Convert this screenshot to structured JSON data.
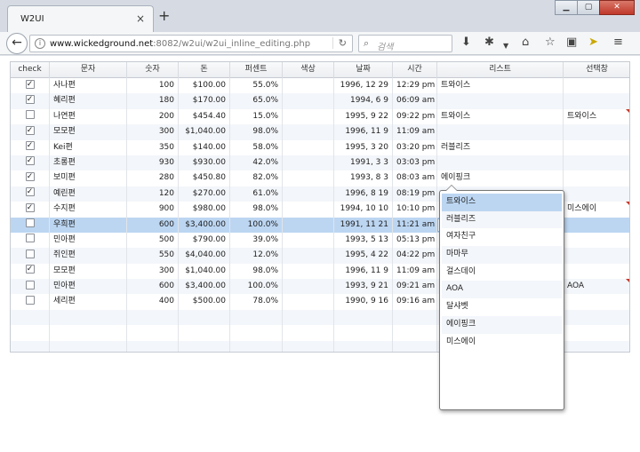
{
  "browser": {
    "tab_title": "W2UI",
    "tab_close": "×",
    "new_tab": "+",
    "url_domain": "www.wickedground.net",
    "url_path": ":8082/w2ui/w2ui_inline_editing.php",
    "search_placeholder": "검색"
  },
  "grid": {
    "columns": [
      "check",
      "문자",
      "숫자",
      "돈",
      "퍼센트",
      "색상",
      "날짜",
      "시간",
      "리스트",
      "선택창"
    ],
    "rows": [
      {
        "check": true,
        "name": "사나편",
        "num": "100",
        "money": "$100.00",
        "pct": "55.0%",
        "date": "1996, 12 29",
        "time": "12:29 pm",
        "list": "트와이스",
        "select": "",
        "flag": false
      },
      {
        "check": true,
        "name": "혜리편",
        "num": "180",
        "money": "$170.00",
        "pct": "65.0%",
        "date": "1994, 6 9",
        "time": "06:09 am",
        "list": "",
        "select": "",
        "flag": false
      },
      {
        "check": false,
        "name": "나연편",
        "num": "200",
        "money": "$454.40",
        "pct": "15.0%",
        "date": "1995, 9 22",
        "time": "09:22 pm",
        "list": "트와이스",
        "select": "트와이스",
        "flag": true
      },
      {
        "check": true,
        "name": "모모편",
        "num": "300",
        "money": "$1,040.00",
        "pct": "98.0%",
        "date": "1996, 11 9",
        "time": "11:09 am",
        "list": "",
        "select": "",
        "flag": false
      },
      {
        "check": true,
        "name": "Kei편",
        "num": "350",
        "money": "$140.00",
        "pct": "58.0%",
        "date": "1995, 3 20",
        "time": "03:20 pm",
        "list": "러블리즈",
        "select": "",
        "flag": false
      },
      {
        "check": true,
        "name": "초롱편",
        "num": "930",
        "money": "$930.00",
        "pct": "42.0%",
        "date": "1991, 3 3",
        "time": "03:03 pm",
        "list": "",
        "select": "",
        "flag": false
      },
      {
        "check": true,
        "name": "보미편",
        "num": "280",
        "money": "$450.80",
        "pct": "82.0%",
        "date": "1993, 8 3",
        "time": "08:03 am",
        "list": "에이핑크",
        "select": "",
        "flag": false
      },
      {
        "check": true,
        "name": "예린편",
        "num": "120",
        "money": "$270.00",
        "pct": "61.0%",
        "date": "1996, 8 19",
        "time": "08:19 pm",
        "list": "",
        "select": "",
        "flag": false
      },
      {
        "check": true,
        "name": "수지편",
        "num": "900",
        "money": "$980.00",
        "pct": "98.0%",
        "date": "1994, 10 10",
        "time": "10:10 pm",
        "list": "",
        "select": "미스에이",
        "flag": true
      },
      {
        "check": false,
        "name": "우희편",
        "num": "600",
        "money": "$3,400.00",
        "pct": "100.0%",
        "date": "1991, 11 21",
        "time": "11:21 am",
        "list": "달샤벳",
        "select": "",
        "flag": false,
        "editing": true
      },
      {
        "check": false,
        "name": "민아편",
        "num": "500",
        "money": "$790.00",
        "pct": "39.0%",
        "date": "1993, 5 13",
        "time": "05:13 pm",
        "list": "걸스데",
        "select": "",
        "flag": false
      },
      {
        "check": false,
        "name": "쥐인편",
        "num": "550",
        "money": "$4,040.00",
        "pct": "12.0%",
        "date": "1995, 4 22",
        "time": "04:22 pm",
        "list": "",
        "select": "",
        "flag": false
      },
      {
        "check": true,
        "name": "모모편",
        "num": "300",
        "money": "$1,040.00",
        "pct": "98.0%",
        "date": "1996, 11 9",
        "time": "11:09 am",
        "list": "",
        "select": "",
        "flag": false
      },
      {
        "check": false,
        "name": "민아편",
        "num": "600",
        "money": "$3,400.00",
        "pct": "100.0%",
        "date": "1993, 9 21",
        "time": "09:21 am",
        "list": "",
        "select": "AOA",
        "flag": true
      },
      {
        "check": false,
        "name": "세리편",
        "num": "400",
        "money": "$500.00",
        "pct": "78.0%",
        "date": "1990, 9 16",
        "time": "09:16 am",
        "list": "",
        "select": "",
        "flag": false
      }
    ],
    "empty_rows": 3
  },
  "dropdown": {
    "items": [
      "트와이스",
      "러블리즈",
      "여자친구",
      "마마무",
      "걸스데이",
      "AOA",
      "달샤벳",
      "에이핑크",
      "미스에이"
    ],
    "active_index": 0
  },
  "colors": {
    "selected_row": "#bcd6f2",
    "alt_row": "#f3f6fa",
    "change_flag": "#c0392b"
  }
}
